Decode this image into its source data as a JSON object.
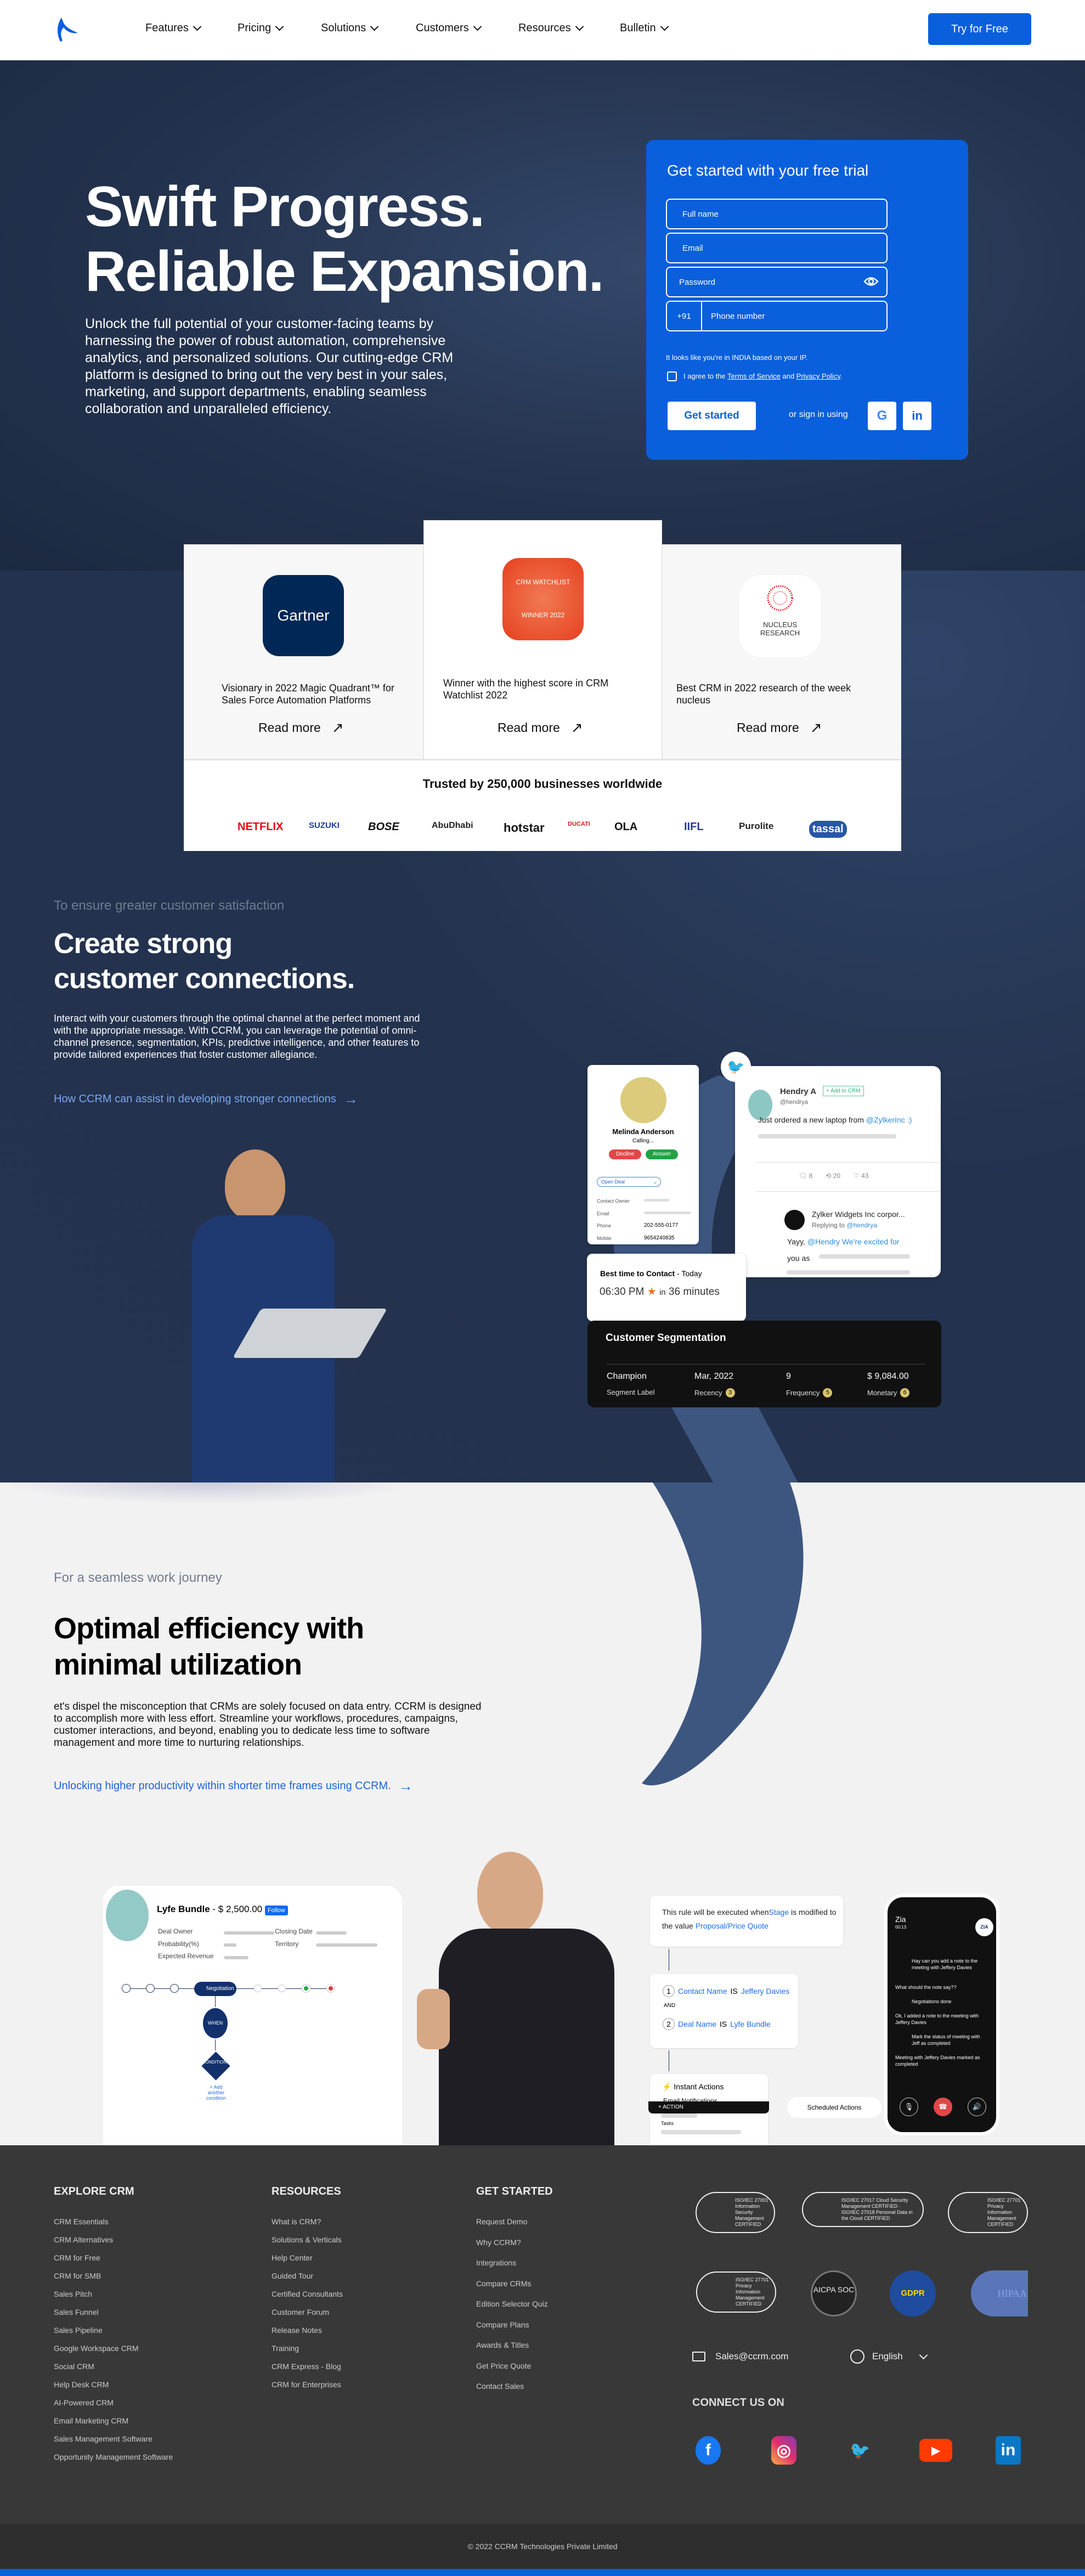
{
  "nav": {
    "items": [
      "Features",
      "Pricing",
      "Solutions",
      "Customers",
      "Resources",
      "Bulletin"
    ],
    "cta": "Try for Free"
  },
  "hero": {
    "title_line1": "Swift Progress.",
    "title_line2": "Reliable Expansion.",
    "description": "Unlock the full potential of your customer-facing teams by harnessing the power of robust automation, comprehensive analytics, and personalized solutions. Our cutting-edge CRM platform is designed to bring out the very best in your sales, marketing, and support departments, enabling seamless collaboration and unparalleled efficiency."
  },
  "signup": {
    "title": "Get started with your free trial",
    "full_name_placeholder": "Full name",
    "email_placeholder": "Email",
    "password_placeholder": "Password",
    "country_code": "+91",
    "phone_placeholder": "Phone number",
    "ip_note": "It looks like you're in INDIA based on your IP.",
    "agree_prefix": "I agree to the",
    "terms": "Terms of Service",
    "and": "and",
    "privacy": "Privacy Policy",
    "submit": "Get started",
    "or_sign_in": "or sign in using",
    "google": "G",
    "linkedin": "in"
  },
  "awards": [
    {
      "logo": "Gartner",
      "text": "Visionary in 2022 Magic Quadrant™ for Sales Force Automation Platforms",
      "link": "Read more"
    },
    {
      "logo": "CRM WATCHLIST WINNER 2022",
      "text": "Winner with the highest score in CRM Watchlist 2022",
      "link": "Read more"
    },
    {
      "logo": "NUCLEUS RESEARCH",
      "text": "Best CRM in 2022 research of the week nucleus",
      "link": "Read more"
    }
  ],
  "trusted": {
    "title": "Trusted by 250,000 businesses worldwide",
    "brands": [
      "NETFLIX",
      "SUZUKI",
      "BOSE",
      "AbuDhabi",
      "hotstar",
      "DUCATI",
      "OLA",
      "IIFL",
      "Purolite",
      "tassal"
    ]
  },
  "connections": {
    "eyebrow": "To ensure greater customer satisfaction",
    "title_line1": "Create strong",
    "title_line2": "customer connections.",
    "description": "Interact with your customers through the optimal channel at the perfect moment and with the appropriate message. With CCRM, you can leverage the potential of omni-channel presence, segmentation, KPIs, predictive intelligence, and other features to provide tailored experiences that foster customer allegiance.",
    "link": "How CCRM can assist in developing stronger connections",
    "contact_card": {
      "name": "Melinda Anderson",
      "status": "Calling...",
      "decline": "Decline",
      "answer": "Answer",
      "deal_select": "Open Deal",
      "fields": [
        {
          "label": "Contact Owner",
          "value": ""
        },
        {
          "label": "Email",
          "value": ""
        },
        {
          "label": "Phone",
          "value": "202-555-0177"
        },
        {
          "label": "Mobile",
          "value": "9654240835"
        }
      ]
    },
    "tweet": {
      "name": "Hendry A",
      "handle": "@hendrya",
      "add": "+ Add to CRM",
      "text": "Just ordered a new laptop from",
      "mention": "@ZylkerInc  :)",
      "replies": "8",
      "retweets": "20",
      "likes": "43",
      "reply_name": "Zylker Widgets Inc corpor...",
      "replying_to": "Replying to",
      "replying_handle": "@hendrya",
      "reply_text": "Yayy,",
      "reply_mention": "@Hendry  We're excited for",
      "reply_tail": "you as"
    },
    "best_time": {
      "label": "Best time to Contact",
      "day": "- Today",
      "time": "06:30 PM",
      "in": "in",
      "eta": "36 minutes"
    },
    "segmentation": {
      "title": "Customer Segmentation",
      "cols": [
        {
          "value": "Champion",
          "label": "Segment Label",
          "score": ""
        },
        {
          "value": "Mar, 2022",
          "label": "Recency",
          "score": "3"
        },
        {
          "value": "9",
          "label": "Frequency",
          "score": "5"
        },
        {
          "value": "$ 9,084.00",
          "label": "Monetary",
          "score": "6"
        }
      ]
    }
  },
  "efficiency": {
    "eyebrow": "For a seamless work journey",
    "title_line1": "Optimal efficiency with",
    "title_line2": "minimal utilization",
    "description": "et's dispel the misconception that CRMs are solely focused on data entry. CCRM is designed to accomplish more with less effort. Streamline your workflows, procedures, campaigns, customer interactions, and beyond, enabling you to dedicate less time to software management and more time to nurturing relationships.",
    "link": "Unlocking higher productivity within shorter time frames using CCRM.",
    "deal": {
      "name": "Lyfe Bundle",
      "amount": "- $ 2,500.00",
      "follow": "Follow",
      "fields_left": [
        "Deal Owner",
        "Probability(%)",
        "Expected Revenue"
      ],
      "fields_right": [
        "Closing Date",
        "Territory"
      ],
      "stage": "Negotiation",
      "when": "WHEN",
      "condition": "CONDITION 1",
      "add_condition": "+ Add another condition"
    },
    "rule": {
      "prefix": "This rule will be executed when",
      "field": "Stage",
      "mid": "is modified to the value",
      "value": "Proposal/Price Quote",
      "conditions": [
        {
          "num": "1",
          "field": "Contact Name",
          "op": "IS",
          "value": "Jeffery Davies"
        },
        {
          "num": "2",
          "field": "Deal Name",
          "op": "IS",
          "value": "Lyfe Bundle"
        }
      ],
      "and": "AND",
      "instant": "Instant Actions",
      "email": "Email Notifications",
      "tasks": "Tasks",
      "action": "+ ACTION",
      "scheduled": "Scheduled Actions"
    },
    "zia": {
      "name": "Zia",
      "timer": "00:13",
      "logo": "ZIA",
      "messages": [
        {
          "from": "user",
          "text": "Hay can you add a note to the meeting with Jeffery Davies"
        },
        {
          "from": "zia",
          "text": "What should the note say??"
        },
        {
          "from": "user",
          "text": "Negotiations done"
        },
        {
          "from": "zia",
          "text": "Ok, I added a note to the meeting with Jeffery Davies"
        },
        {
          "from": "user",
          "text": "Mark the status of meeting with Jeff as completed"
        },
        {
          "from": "zia",
          "text": "Meeting with Jeffery Davies marked as completed"
        }
      ]
    }
  },
  "footer": {
    "columns": [
      {
        "title": "EXPLORE CRM",
        "links": [
          "CRM Essentials",
          "CRM Alternatives",
          "CRM for Free",
          "CRM for SMB",
          "Sales Pitch",
          "Sales Funnel",
          "Sales Pipeline",
          "Google Workspace CRM",
          "Social CRM",
          "Help Desk CRM",
          "AI-Powered CRM",
          "Email Marketing CRM",
          "Sales Management Software",
          "Opportunity Management Software"
        ]
      },
      {
        "title": "RESOURCES",
        "links": [
          "What is CRM?",
          "Solutions & Verticals",
          "Help Center",
          "Guided Tour",
          "Certified Consultants",
          "Customer Forum",
          "Release Notes",
          "Training",
          "CRM Express - Blog",
          "CRM for Enterprises"
        ]
      },
      {
        "title": "GET STARTED",
        "links": [
          "Request Demo",
          "Why CCRM?",
          "Integrations",
          "Compare CRMs",
          "Edition Selector Quiz",
          "Compare Plans",
          "Awards & Titles",
          "Get Price Quote",
          "Contact Sales"
        ]
      }
    ],
    "certs": [
      "ISO/IEC 27001 Information Security Management CERTIFIED",
      "ISO/IEC 27017 Cloud Security Management CERTIFIED · ISO/IEC 27018 Personal Data in the Cloud CERTIFIED",
      "ISO/IEC 27701 Privacy Information Management CERTIFIED",
      "ISO/IEC 27701 Privacy Information Management CERTIFIED",
      "AICPA SOC",
      "GDPR",
      "HIPAA"
    ],
    "email": "Sales@ccrm.com",
    "language": "English",
    "connect": "CONNECT US ON",
    "copyright": "© 2022 CCRM Technologies Private Limited"
  }
}
